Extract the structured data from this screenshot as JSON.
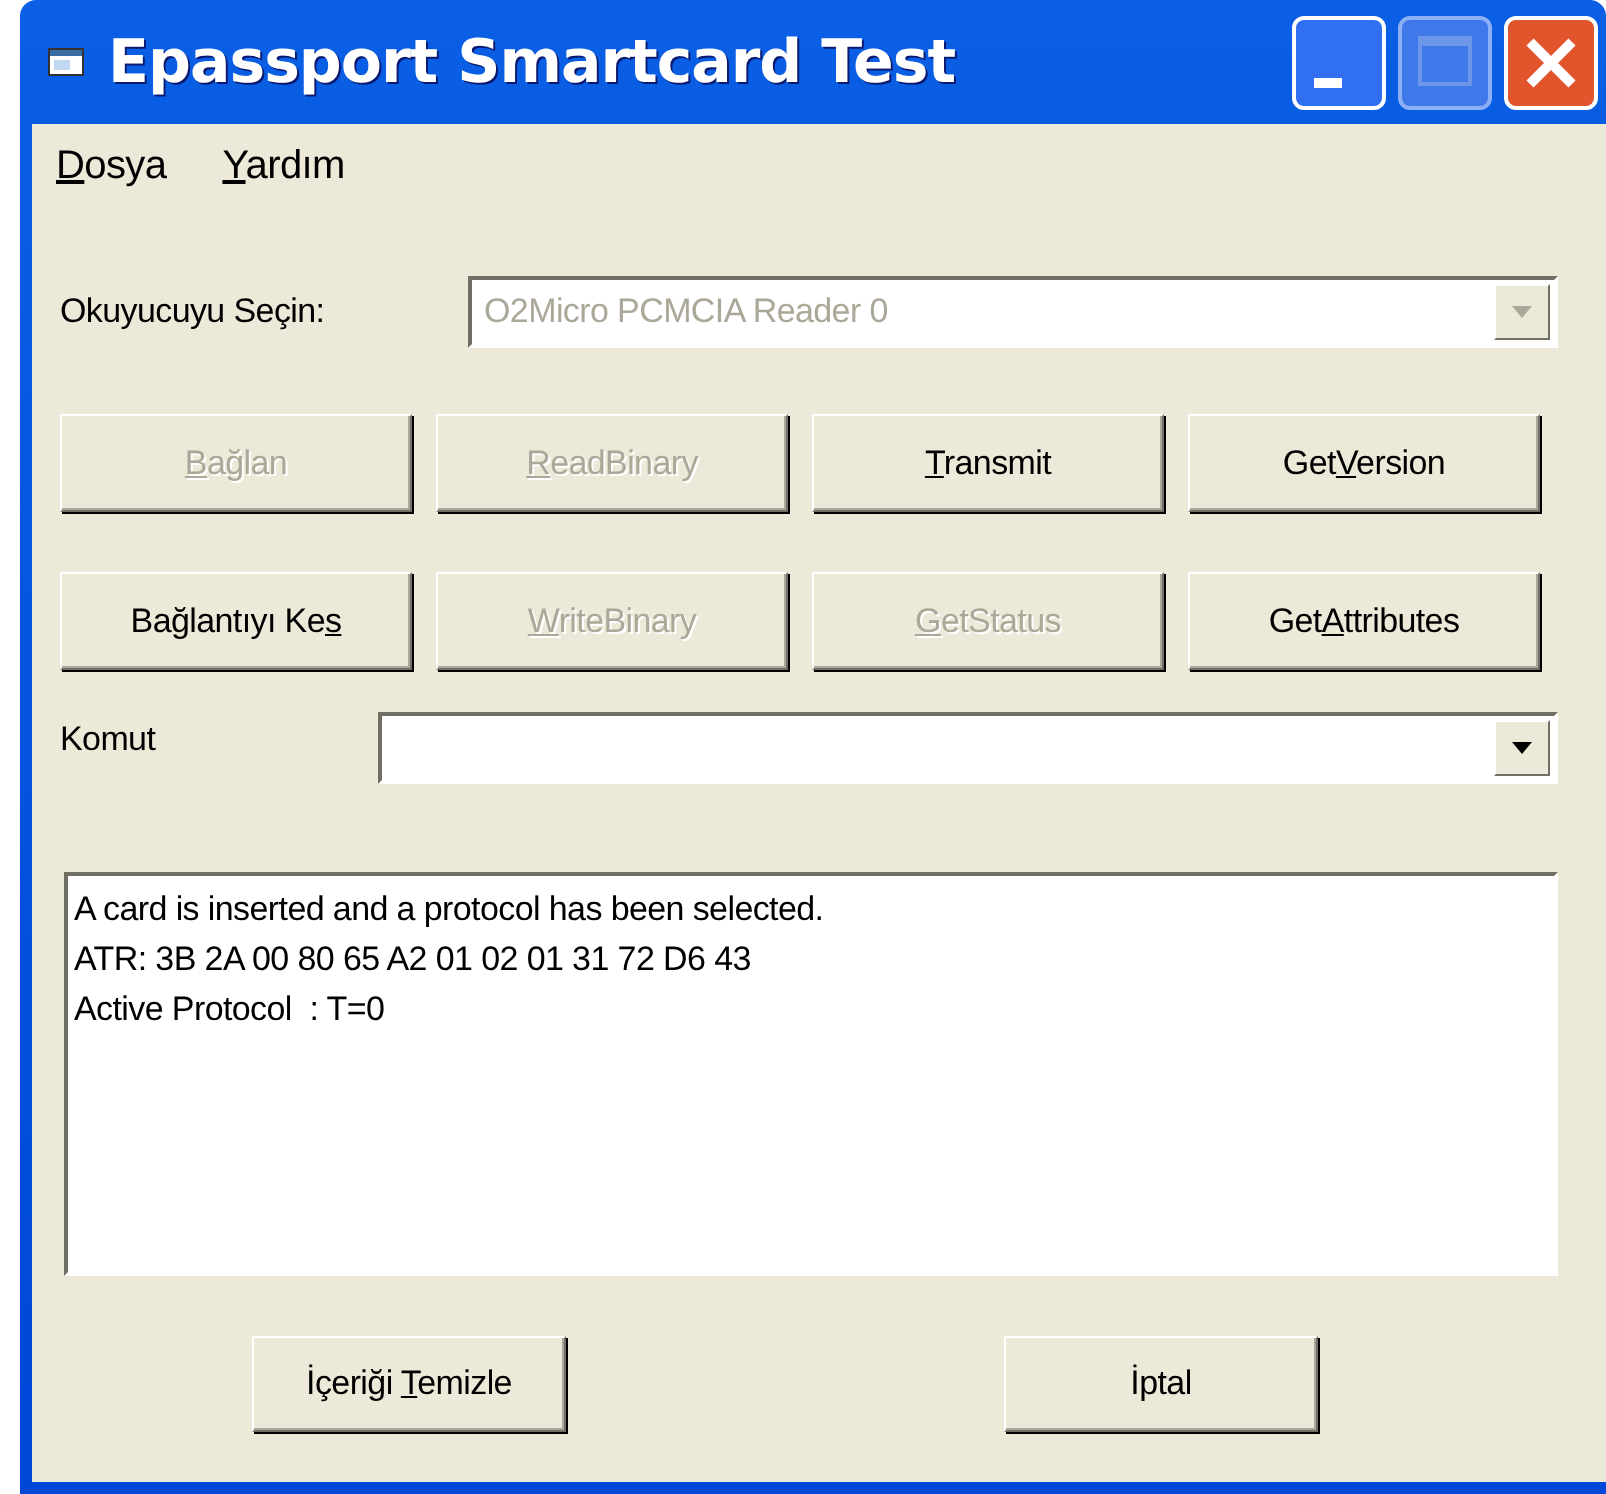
{
  "window": {
    "title": "Epassport Smartcard Test"
  },
  "menu": [
    {
      "key": "D",
      "post": "osya"
    },
    {
      "key": "Y",
      "post": "ardım"
    }
  ],
  "reader": {
    "label": "Okuyucuyu Seçin:",
    "value": "O2Micro PCMCIA Reader 0",
    "disabled": true
  },
  "buttons": [
    {
      "key": "B",
      "post": "ağlan",
      "disabled": true
    },
    {
      "key": "R",
      "post": "eadBinary",
      "disabled": true
    },
    {
      "key": "T",
      "post": "ransmit",
      "disabled": false
    },
    {
      "pre": "Get",
      "key": "V",
      "post": "ersion",
      "disabled": false
    },
    {
      "pre": "Bağlantıyı Ke",
      "key": "s",
      "disabled": false
    },
    {
      "key": "W",
      "post": "riteBinary",
      "disabled": true
    },
    {
      "key": "G",
      "post": "etStatus",
      "disabled": true
    },
    {
      "pre": "Get",
      "key": "A",
      "post": "ttributes",
      "disabled": false
    }
  ],
  "command": {
    "label": "Komut",
    "disabled": false
  },
  "output": {
    "lines": [
      "A card is inserted and a protocol has been selected.",
      "ATR: 3B 2A 00 80 65 A2 01 02 01 31 72 D6 43",
      "Active Protocol  : T=0"
    ]
  },
  "footer_buttons": [
    {
      "pre": "İçeriği ",
      "key": "T",
      "post": "emizle",
      "disabled": false
    },
    {
      "pre": "İptal",
      "disabled": false
    }
  ]
}
